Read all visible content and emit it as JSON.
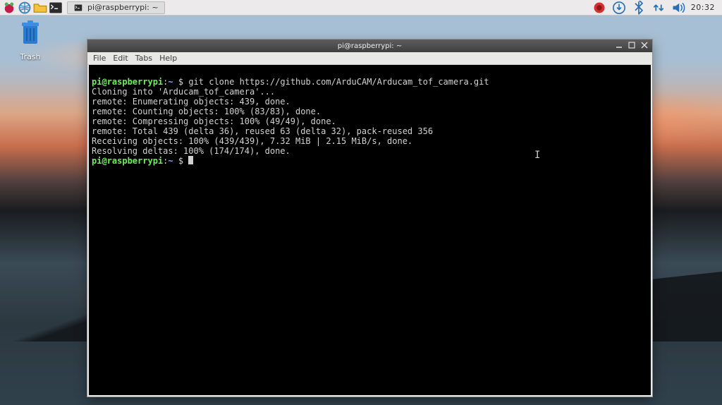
{
  "panel": {
    "taskbar_item_label": "pi@raspberrypi: ~",
    "clock": "20:32",
    "tray_icons": [
      "record-icon",
      "download-icon",
      "bluetooth-icon",
      "network-icon",
      "volume-icon"
    ]
  },
  "desktop": {
    "trash_label": "Trash"
  },
  "window": {
    "title": "pi@raspberrypi: ~",
    "menus": [
      "File",
      "Edit",
      "Tabs",
      "Help"
    ]
  },
  "terminal": {
    "prompt_user": "pi@raspberrypi",
    "prompt_sep": ":",
    "prompt_path": "~",
    "prompt_symbol": "$",
    "command1": "git clone https://github.com/ArduCAM/Arducam_tof_camera.git",
    "lines": [
      "Cloning into 'Arducam_tof_camera'...",
      "remote: Enumerating objects: 439, done.",
      "remote: Counting objects: 100% (83/83), done.",
      "remote: Compressing objects: 100% (49/49), done.",
      "remote: Total 439 (delta 36), reused 63 (delta 32), pack-reused 356",
      "Receiving objects: 100% (439/439), 7.32 MiB | 2.15 MiB/s, done.",
      "Resolving deltas: 100% (174/174), done."
    ]
  },
  "colors": {
    "prompt_user": "#6fef5a",
    "prompt_path": "#7aa9ff",
    "panel_bg": "#eceaea",
    "terminal_bg": "#000000",
    "terminal_fg": "#d0d0d0"
  }
}
